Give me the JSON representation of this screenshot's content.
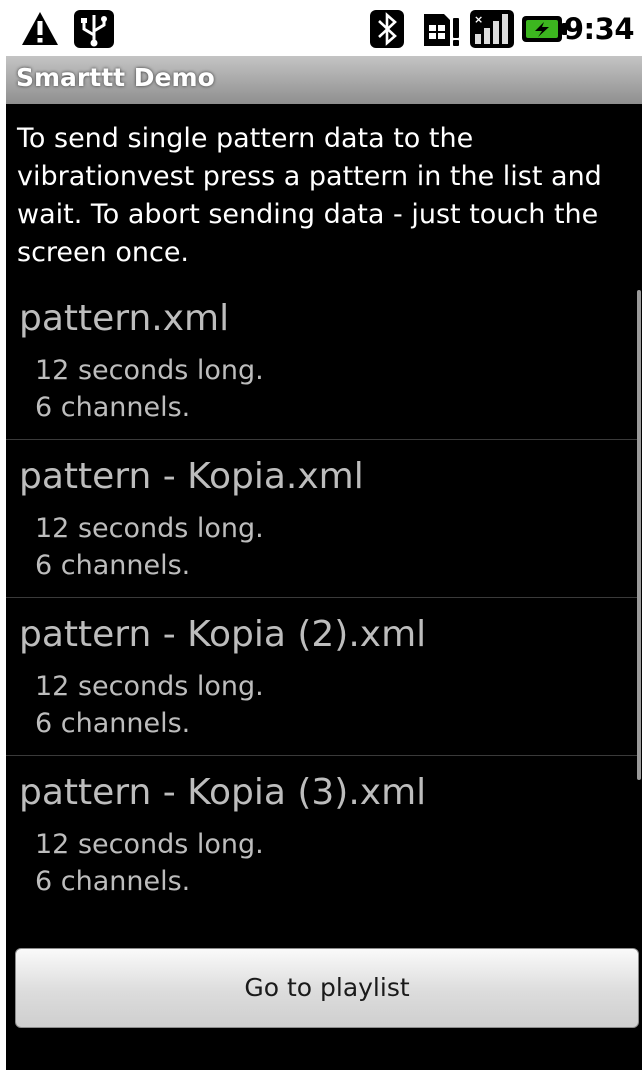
{
  "status_bar": {
    "time": "9:34",
    "icons": [
      "warning-icon",
      "usb-icon",
      "bluetooth-icon",
      "sim-icon",
      "signal-icon",
      "battery-charging-icon"
    ]
  },
  "app": {
    "title": "Smarttt Demo"
  },
  "intro": {
    "text": "To send single pattern data to the vibrationvest press a pattern in the list and wait. To abort sending data - just touch the screen once."
  },
  "patterns": [
    {
      "name": "pattern.xml",
      "duration": "12 seconds long.",
      "channels": "6 channels."
    },
    {
      "name": "pattern - Kopia.xml",
      "duration": "12 seconds long.",
      "channels": "6 channels."
    },
    {
      "name": "pattern - Kopia (2).xml",
      "duration": "12 seconds long.",
      "channels": "6 channels."
    },
    {
      "name": "pattern - Kopia (3).xml",
      "duration": "12 seconds long.",
      "channels": "6 channels."
    }
  ],
  "buttons": {
    "playlist_label": "Go to playlist"
  },
  "colors": {
    "background": "#000000",
    "list_text": "#bdbdbd",
    "title_bar": "#a8a8a8",
    "battery_green": "#3cb61f"
  }
}
